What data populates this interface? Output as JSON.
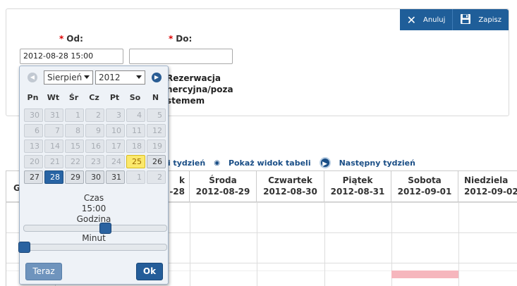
{
  "toolbar": {
    "cancel_label": "Anuluj",
    "save_label": "Zapisz",
    "cancel_icon": "x-icon",
    "save_icon": "floppy-disk-icon"
  },
  "form": {
    "from_label": "Od:",
    "to_label": "Do:",
    "required_mark": "*",
    "from_value": "2012-08-28 15:00",
    "to_value": "",
    "option_line1": "Rezerwacja",
    "option_line2": "nercyjna/poza",
    "option_line3": "stemem"
  },
  "week_nav": {
    "prev_label": "ni tydzień",
    "table_view_label": "Pokaż widok tabeli",
    "next_label": "Następny tydzień"
  },
  "grid": {
    "first_col_header": "G",
    "days": [
      {
        "name": "k",
        "date": "-28"
      },
      {
        "name": "Środa",
        "date": "2012-08-29"
      },
      {
        "name": "Czwartek",
        "date": "2012-08-30"
      },
      {
        "name": "Piątek",
        "date": "2012-08-31"
      },
      {
        "name": "Sobota",
        "date": "2012-09-01"
      },
      {
        "name": "Niedziela",
        "date": "2012-09-02"
      }
    ]
  },
  "calendar": {
    "month": "Sierpień",
    "year": "2012",
    "weekdays": [
      "Pn",
      "Wt",
      "Śr",
      "Cz",
      "Pt",
      "So",
      "N"
    ],
    "weeks": [
      [
        "30",
        "31",
        "1",
        "2",
        "3",
        "4",
        "5"
      ],
      [
        "6",
        "7",
        "8",
        "9",
        "10",
        "11",
        "12"
      ],
      [
        "13",
        "14",
        "15",
        "16",
        "17",
        "18",
        "19"
      ],
      [
        "20",
        "21",
        "22",
        "23",
        "24",
        "25",
        "26"
      ],
      [
        "27",
        "28",
        "29",
        "30",
        "31",
        "1",
        "2"
      ]
    ],
    "time_label": "Czas",
    "time_value": "15:00",
    "hour_label": "Godzina",
    "minute_label": "Minut",
    "hour_value": 15,
    "minute_value": 0,
    "now_button": "Teraz",
    "ok_button": "Ok"
  }
}
